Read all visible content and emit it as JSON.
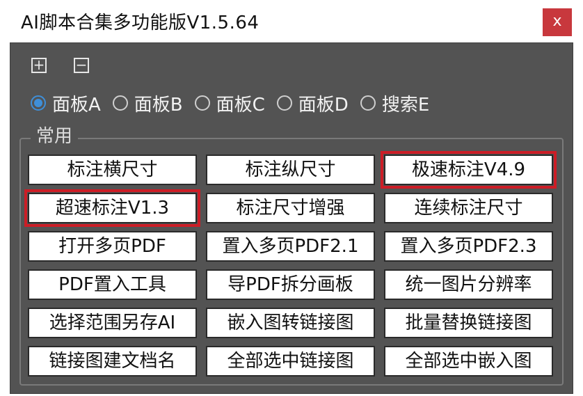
{
  "window": {
    "title": "AI脚本合集多功能版V1.5.64",
    "close_label": "x"
  },
  "toolbar": {
    "expand_label": "+",
    "collapse_label": "−"
  },
  "panels": [
    {
      "label": "面板A",
      "checked": true
    },
    {
      "label": "面板B",
      "checked": false
    },
    {
      "label": "面板C",
      "checked": false
    },
    {
      "label": "面板D",
      "checked": false
    },
    {
      "label": "搜索E",
      "checked": false
    }
  ],
  "group": {
    "label": "常用"
  },
  "buttons": [
    {
      "label": "标注横尺寸",
      "highlighted": false
    },
    {
      "label": "标注纵尺寸",
      "highlighted": false
    },
    {
      "label": "极速标注V4.9",
      "highlighted": true
    },
    {
      "label": "超速标注V1.3",
      "highlighted": true
    },
    {
      "label": "标注尺寸增强",
      "highlighted": false
    },
    {
      "label": "连续标注尺寸",
      "highlighted": false
    },
    {
      "label": "打开多页PDF",
      "highlighted": false
    },
    {
      "label": "置入多页PDF2.1",
      "highlighted": false
    },
    {
      "label": "置入多页PDF2.3",
      "highlighted": false
    },
    {
      "label": "PDF置入工具",
      "highlighted": false
    },
    {
      "label": "导PDF拆分画板",
      "highlighted": false
    },
    {
      "label": "统一图片分辨率",
      "highlighted": false
    },
    {
      "label": "选择范围另存AI",
      "highlighted": false
    },
    {
      "label": "嵌入图转链接图",
      "highlighted": false
    },
    {
      "label": "批量替换链接图",
      "highlighted": false
    },
    {
      "label": "链接图建文档名",
      "highlighted": false
    },
    {
      "label": "全部选中链接图",
      "highlighted": false
    },
    {
      "label": "全部选中嵌入图",
      "highlighted": false
    }
  ],
  "colors": {
    "panel_bg": "#535353",
    "accent": "#3f8fd8",
    "close_bg": "#c8383d",
    "highlight": "#cc1d26"
  }
}
